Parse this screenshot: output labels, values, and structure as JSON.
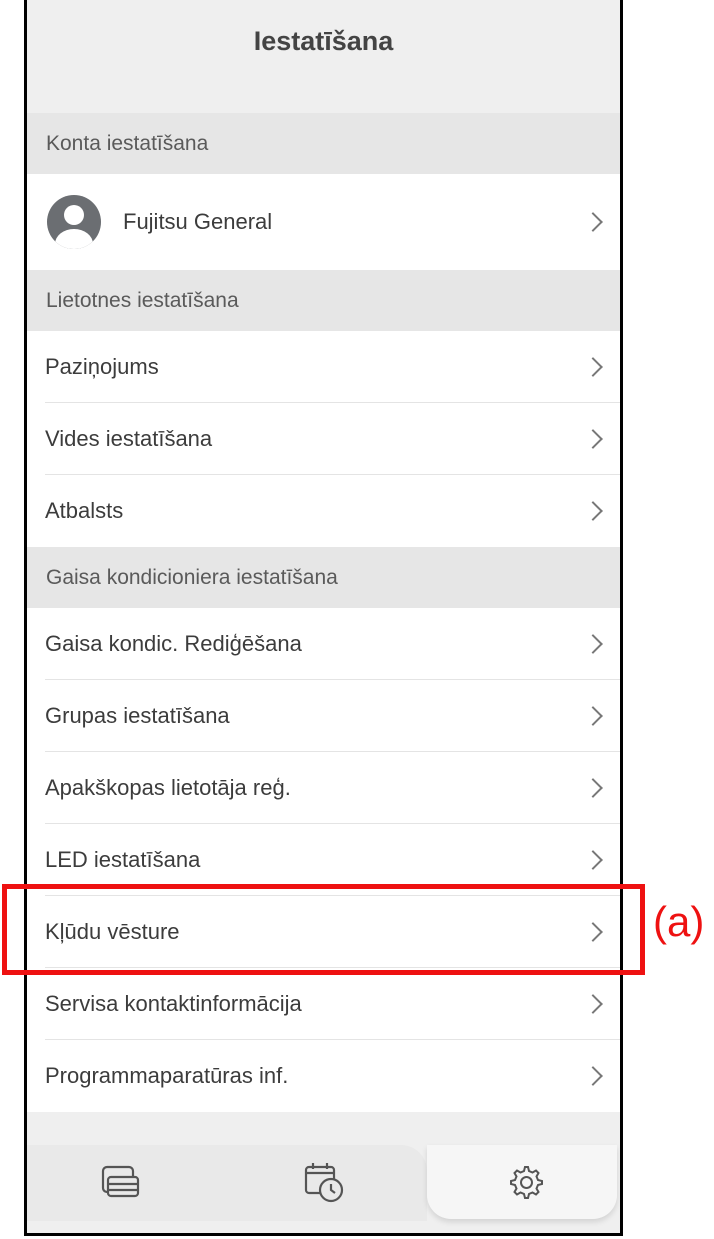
{
  "header": {
    "title": "Iestatīšana"
  },
  "sections": {
    "account": "Konta iestatīšana",
    "app": "Lietotnes iestatīšana",
    "ac": "Gaisa kondicioniera iestatīšana"
  },
  "account": {
    "name": "Fujitsu General"
  },
  "app_items": [
    "Paziņojums",
    "Vides iestatīšana",
    "Atbalsts"
  ],
  "ac_items": [
    "Gaisa kondic. Rediģēšana",
    "Grupas iestatīšana",
    "Apakškopas lietotāja reģ.",
    "LED iestatīšana",
    "Kļūdu vēsture",
    "Servisa kontaktinformācija",
    "Programmaparatūras inf."
  ],
  "annotation": {
    "label": "(a)",
    "color": "#ee1111"
  },
  "tabs": [
    {
      "name": "devices",
      "icon": "devices-icon"
    },
    {
      "name": "timer",
      "icon": "timer-icon"
    },
    {
      "name": "settings",
      "icon": "gear-icon",
      "active": true
    }
  ]
}
